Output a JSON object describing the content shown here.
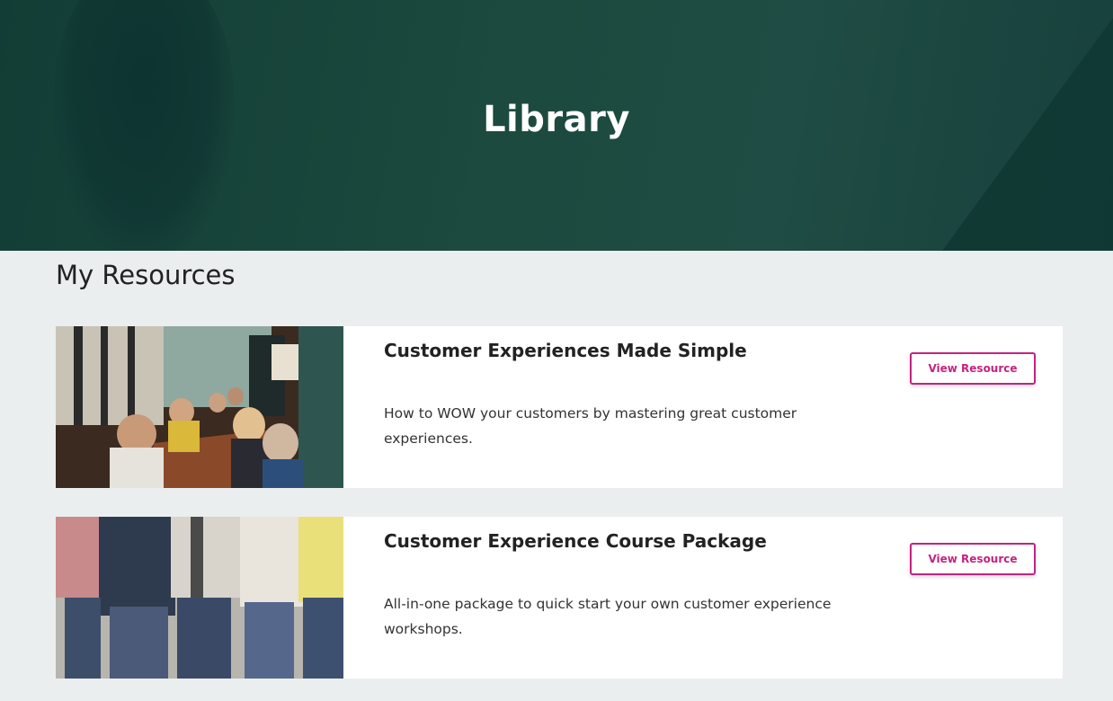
{
  "hero": {
    "title": "Library"
  },
  "section": {
    "title": "My Resources"
  },
  "resources": [
    {
      "title": "Customer Experiences Made Simple",
      "description": "How to WOW your customers by mastering great customer experiences.",
      "button_label": "View Resource"
    },
    {
      "title": "Customer Experience Course Package",
      "description": "All-in-one package to quick start your own customer experience workshops.",
      "button_label": "View Resource"
    }
  ],
  "colors": {
    "accent": "#c4237f",
    "hero": "#1c4a3e",
    "page_bg": "#ebeeee"
  }
}
